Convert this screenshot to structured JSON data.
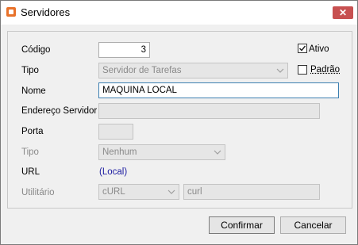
{
  "window": {
    "title": "Servidores",
    "close_glyph": "✕"
  },
  "form": {
    "codigo": {
      "label": "Código",
      "value": "3"
    },
    "ativo": {
      "label": "Ativo",
      "checked": true
    },
    "tipo": {
      "label": "Tipo",
      "value": "Servidor de Tarefas"
    },
    "padrao": {
      "label": "Padrão",
      "checked": false
    },
    "nome": {
      "label": "Nome",
      "value": "MAQUINA LOCAL"
    },
    "endereco": {
      "label": "Endereço Servidor",
      "value": ""
    },
    "porta": {
      "label": "Porta",
      "value": ""
    },
    "tipo2": {
      "label": "Tipo",
      "value": "Nenhum"
    },
    "url": {
      "label": "URL",
      "value": "(Local)"
    },
    "utilitario": {
      "label": "Utilitário",
      "select_value": "cURL",
      "text_value": "curl"
    }
  },
  "buttons": {
    "confirm": "Confirmar",
    "cancel": "Cancelar"
  },
  "colors": {
    "accent": "#3c7fb1",
    "link": "#1a1aa0",
    "close": "#c75050",
    "app_icon": "#e8722a"
  }
}
